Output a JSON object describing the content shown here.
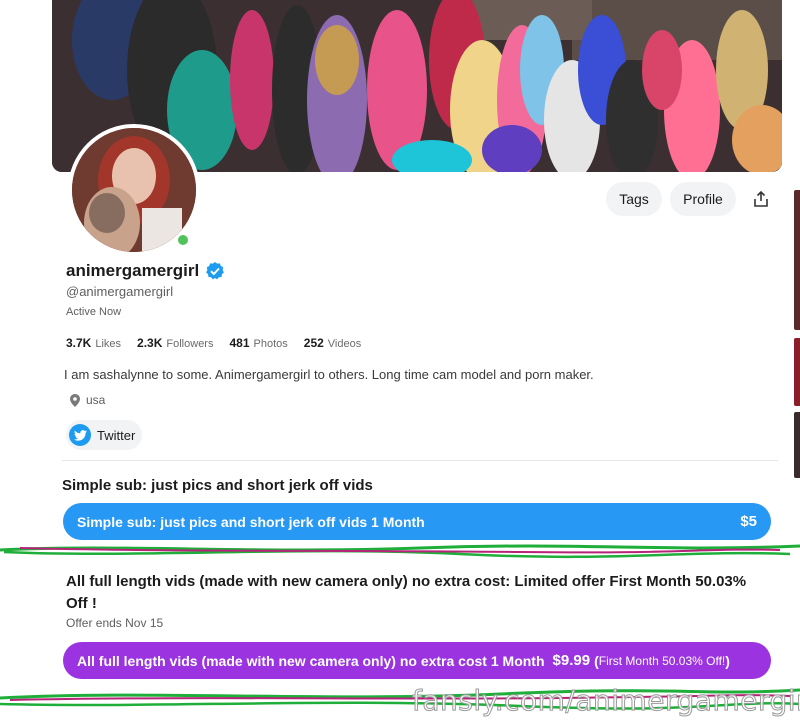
{
  "header": {
    "tags_label": "Tags",
    "profile_label": "Profile"
  },
  "profile": {
    "display_name": "animergamergirl",
    "username": "@animergamergirl",
    "status": "Active Now",
    "stats": [
      {
        "value": "3.7K",
        "label": "Likes"
      },
      {
        "value": "2.3K",
        "label": "Followers"
      },
      {
        "value": "481",
        "label": "Photos"
      },
      {
        "value": "252",
        "label": "Videos"
      }
    ],
    "bio": "I am sashalynne to some. Animergamergirl to others. Long time cam model and porn maker.",
    "location": "usa",
    "social": "Twitter"
  },
  "tiers": {
    "simple": {
      "title": "Simple sub: just pics and short jerk off vids",
      "button_label": "Simple sub: just pics and short jerk off vids 1 Month",
      "price": "$5"
    },
    "full": {
      "title": "All full length vids (made with new camera only) no extra cost: Limited offer First Month 50.03% Off !",
      "offer_ends": "Offer ends Nov 15",
      "button_label": "All full length vids (made with new camera only) no extra cost 1 Month",
      "price": "$9.99",
      "price_note_open": "(",
      "price_note": "First Month 50.03% Off!",
      "price_note_close": ")"
    }
  },
  "watermark": "fansly.com/animergamergirl",
  "colors": {
    "blue_button": "#2798f4",
    "purple_button": "#9b34e0",
    "online": "#4fc25b",
    "verified": "#1d9bf0",
    "scribble_green": "#1fae3a",
    "scribble_magenta": "#b8237a"
  },
  "icons": {
    "verified": "verified-badge-icon",
    "share": "share-icon",
    "location": "location-pin-icon",
    "twitter": "twitter-bird-icon"
  }
}
